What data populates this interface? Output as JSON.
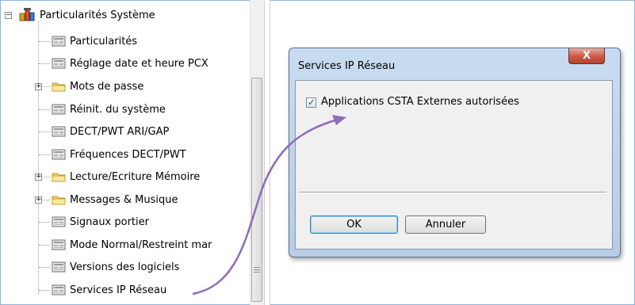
{
  "tree": {
    "root_label": "Particularités Système",
    "items": [
      {
        "label": "Particularités",
        "type": "leaf"
      },
      {
        "label": "Réglage date et heure PCX",
        "type": "leaf"
      },
      {
        "label": "Mots de passe",
        "type": "folder"
      },
      {
        "label": "Réinit. du système",
        "type": "leaf"
      },
      {
        "label": "DECT/PWT ARI/GAP",
        "type": "leaf"
      },
      {
        "label": "Fréquences DECT/PWT",
        "type": "leaf"
      },
      {
        "label": "Lecture/Ecriture Mémoire",
        "type": "folder"
      },
      {
        "label": "Messages & Musique",
        "type": "folder"
      },
      {
        "label": "Signaux portier",
        "type": "leaf"
      },
      {
        "label": "Mode Normal/Restreint mar",
        "type": "leaf"
      },
      {
        "label": "Versions des logiciels",
        "type": "leaf"
      },
      {
        "label": "Services IP Réseau",
        "type": "leaf"
      }
    ]
  },
  "dialog": {
    "title": "Services IP Réseau",
    "close_glyph": "X",
    "checkbox_label": "Applications CSTA Externes autorisées",
    "checkbox_checked": true,
    "ok_label": "OK",
    "cancel_label": "Annuler"
  },
  "colors": {
    "arrow": "#8e6cb8",
    "folder": "#f5d77a",
    "frame": "#8db3d9"
  }
}
